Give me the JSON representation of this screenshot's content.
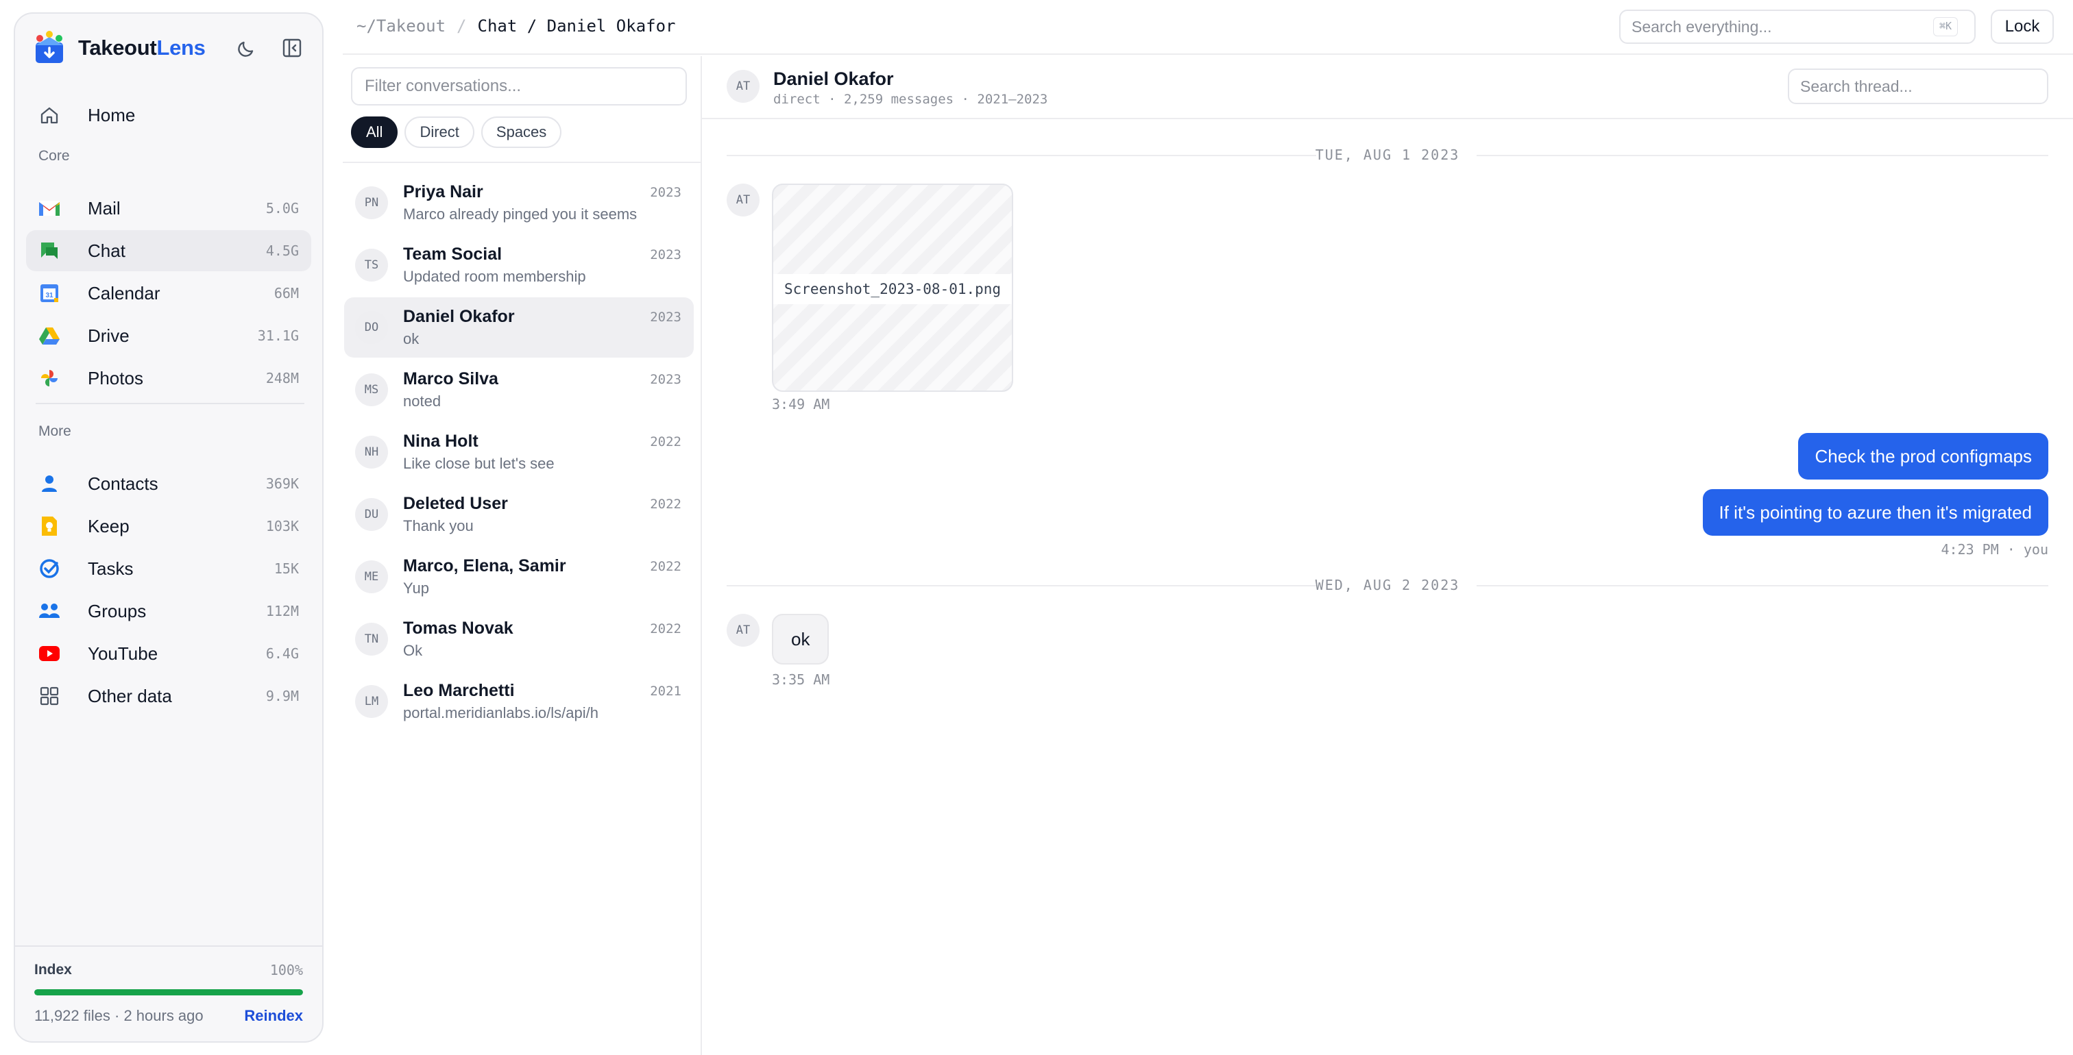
{
  "brand": {
    "name_part1": "Takeout",
    "name_part2": "Lens"
  },
  "topbar": {
    "crumb_root": "~/Takeout",
    "crumb_sep": "/",
    "crumb_current": "Chat / Daniel Okafor",
    "search_placeholder": "Search everything...",
    "search_kbd": "⌘K",
    "lock_label": "Lock"
  },
  "sidebar": {
    "home_label": "Home",
    "core_title": "Core",
    "more_title": "More",
    "core_items": [
      {
        "label": "Mail",
        "size": "5.0G",
        "icon": "gmail-icon"
      },
      {
        "label": "Chat",
        "size": "4.5G",
        "icon": "chat-icon"
      },
      {
        "label": "Calendar",
        "size": "66M",
        "icon": "calendar-icon"
      },
      {
        "label": "Drive",
        "size": "31.1G",
        "icon": "drive-icon"
      },
      {
        "label": "Photos",
        "size": "248M",
        "icon": "photos-icon"
      }
    ],
    "more_items": [
      {
        "label": "Contacts",
        "size": "369K",
        "icon": "contacts-icon"
      },
      {
        "label": "Keep",
        "size": "103K",
        "icon": "keep-icon"
      },
      {
        "label": "Tasks",
        "size": "15K",
        "icon": "tasks-icon"
      },
      {
        "label": "Groups",
        "size": "112M",
        "icon": "groups-icon"
      },
      {
        "label": "YouTube",
        "size": "6.4G",
        "icon": "youtube-icon"
      },
      {
        "label": "Other data",
        "size": "9.9M",
        "icon": "grid-icon"
      }
    ],
    "index": {
      "title": "Index",
      "percent_label": "100%",
      "progress": 1.0,
      "meta": "11,922 files · 2 hours ago",
      "reindex_label": "Reindex"
    }
  },
  "conversations": {
    "filter_placeholder": "Filter conversations...",
    "chips": [
      "All",
      "Direct",
      "Spaces"
    ],
    "active_chip": "All",
    "items": [
      {
        "initials": "PN",
        "name": "Priya Nair",
        "preview": "Marco already pinged you it seems",
        "year": "2023"
      },
      {
        "initials": "TS",
        "name": "Team Social",
        "preview": "Updated room membership",
        "year": "2023"
      },
      {
        "initials": "DO",
        "name": "Daniel Okafor",
        "preview": "ok",
        "year": "2023"
      },
      {
        "initials": "MS",
        "name": "Marco Silva",
        "preview": "noted",
        "year": "2023"
      },
      {
        "initials": "NH",
        "name": "Nina Holt",
        "preview": "Like close but let's see",
        "year": "2022"
      },
      {
        "initials": "DU",
        "name": "Deleted User",
        "preview": "Thank you",
        "year": "2022"
      },
      {
        "initials": "ME",
        "name": "Marco, Elena, Samir",
        "preview": "Yup",
        "year": "2022"
      },
      {
        "initials": "TN",
        "name": "Tomas Novak",
        "preview": "Ok",
        "year": "2022"
      },
      {
        "initials": "LM",
        "name": "Leo Marchetti",
        "preview": "portal.meridianlabs.io/ls/api/h",
        "year": "2021"
      }
    ]
  },
  "thread": {
    "avatar": "AT",
    "name": "Daniel Okafor",
    "meta": "direct · 2,259 messages · 2021–2023",
    "search_placeholder": "Search thread...",
    "day1": "TUE, AUG 1 2023",
    "attachment_avatar": "AT",
    "attachment_name": "Screenshot_2023-08-01.png",
    "attachment_time": "3:49 AM",
    "out_msg1": "Check the prod configmaps",
    "out_msg2": "If it's pointing to azure then it's migrated",
    "out_time": "4:23 PM · you",
    "day2": "WED, AUG 2 2023",
    "in_avatar": "AT",
    "in_msg": "ok",
    "in_time": "3:35 AM"
  }
}
